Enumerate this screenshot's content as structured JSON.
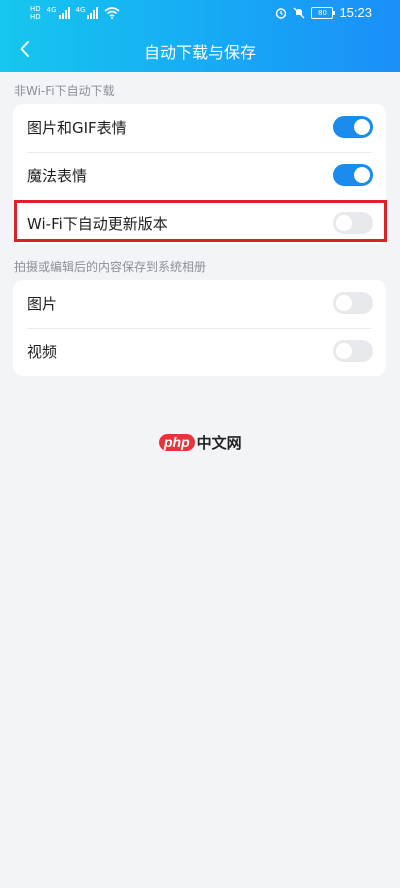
{
  "status_bar": {
    "sim1_label": "HD",
    "sim2_label": "HD",
    "net1_label": "4G",
    "net2_label": "4G",
    "battery": "80",
    "time": "15:23",
    "icons": [
      "signal-icon",
      "wifi-icon",
      "alarm-icon",
      "mute-icon",
      "battery-icon"
    ]
  },
  "header": {
    "title": "自动下载与保存",
    "back_icon": "chevron-left-icon"
  },
  "sections": [
    {
      "label": "非Wi-Fi下自动下载",
      "items": [
        {
          "label": "图片和GIF表情",
          "enabled": true
        },
        {
          "label": "魔法表情",
          "enabled": true
        },
        {
          "label": "Wi-Fi下自动更新版本",
          "enabled": false
        }
      ]
    },
    {
      "label": "拍摄或编辑后的内容保存到系统相册",
      "items": [
        {
          "label": "图片",
          "enabled": false
        },
        {
          "label": "视频",
          "enabled": false
        }
      ]
    }
  ],
  "watermark": {
    "badge": "php",
    "text": "中文网"
  },
  "colors": {
    "header_start": "#16c7ee",
    "header_end": "#1b8ff8",
    "toggle_on": "#1a8cf0",
    "toggle_off": "#e8e9ec",
    "highlight": "#d8232a",
    "background": "#f3f4f7"
  }
}
